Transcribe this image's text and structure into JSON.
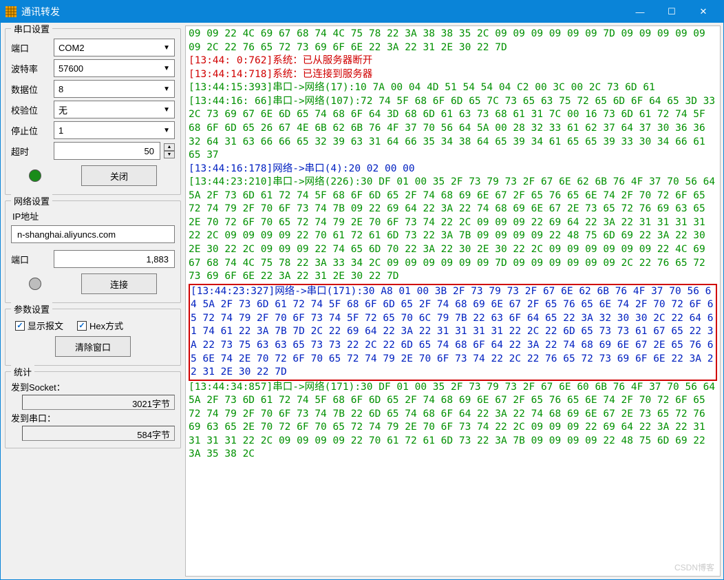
{
  "window": {
    "title": "通讯转发"
  },
  "titlebar": {
    "min": "—",
    "max": "☐",
    "close": "✕"
  },
  "serial": {
    "legend": "串口设置",
    "port_label": "端口",
    "port_value": "COM2",
    "baud_label": "波特率",
    "baud_value": "57600",
    "databits_label": "数据位",
    "databits_value": "8",
    "parity_label": "校验位",
    "parity_value": "无",
    "stopbits_label": "停止位",
    "stopbits_value": "1",
    "timeout_label": "超时",
    "timeout_value": "50",
    "close_btn": "关闭"
  },
  "net": {
    "legend": "网络设置",
    "ip_label": "IP地址",
    "ip_value": "n-shanghai.aliyuncs.com",
    "port_label": "端口",
    "port_value": "1,883",
    "connect_btn": "连接"
  },
  "params": {
    "legend": "参数设置",
    "show_packet": "显示报文",
    "hex_mode": "Hex方式",
    "clear_btn": "清除窗口"
  },
  "stats": {
    "legend": "统计",
    "to_socket_label": "发到Socket：",
    "to_socket_value": "3021字节",
    "to_serial_label": "发到串口：",
    "to_serial_value": "584字节"
  },
  "log": [
    {
      "c": "g",
      "t": "09 09 22 4C 69 67 68 74 4C 75 78 22 3A 38 38 35 2C 09 09 09 09 09 09 7D 09 09 09 09 09 09 2C 22 76 65 72 73 69 6F 6E 22 3A 22 31 2E 30 22 7D"
    },
    {
      "c": "r",
      "t": "[13:44: 0:762]系统：已从服务器断开"
    },
    {
      "c": "r",
      "t": "[13:44:14:718]系统：已连接到服务器"
    },
    {
      "c": "g",
      "t": "[13:44:15:393]串口->网络(17):10 7A 00 04 4D 51 54 54 04 C2 00 3C 00 2C 73 6D 61"
    },
    {
      "c": "g",
      "t": "[13:44:16: 66]串口->网络(107):72 74 5F 68 6F 6D 65 7C 73 65 63 75 72 65 6D 6F 64 65 3D 33 2C 73 69 67 6E 6D 65 74 68 6F 64 3D 68 6D 61 63 73 68 61 31 7C 00 16 73 6D 61 72 74 5F 68 6F 6D 65 26 67 4E 6B 62 6B 76 4F 37 70 56 64 5A 00 28 32 33 61 62 37 64 37 30 36 36 32 64 31 63 66 66 65 32 39 63 31 64 66 35 34 38 64 65 39 34 61 65 65 39 33 30 34 66 61 65 37"
    },
    {
      "c": "b",
      "t": "[13:44:16:178]网络->串口(4):20 02 00 00"
    },
    {
      "c": "g",
      "t": "[13:44:23:210]串口->网络(226):30 DF 01 00 35 2F 73 79 73 2F 67 6E 62 6B 76 4F 37 70 56 64 5A 2F 73 6D 61 72 74 5F 68 6F 6D 65 2F 74 68 69 6E 67 2F 65 76 65 6E 74 2F 70 72 6F 65 72 74 79 2F 70 6F 73 74 7B 09 22 69 64 22 3A 22 74 68 69 6E 67 2E 73 65 72 76 69 63 65 2E 70 72 6F 70 65 72 74 79 2E 70 6F 73 74 22 2C 09 09 09 22 69 64 22 3A 22 31 31 31 31 22 2C 09 09 09 09 22 70 61 72 61 6D 73 22 3A 7B 09 09 09 09 22 48 75 6D 69 22 3A 22 30 2E 30 22 2C 09 09 09 22 74 65 6D 70 22 3A 22 30 2E 30 22 2C 09 09 09 09 09 09 22 4C 69 67 68 74 4C 75 78 22 3A 33 34 2C 09 09 09 09 09 09 7D 09 09 09 09 09 09 2C 22 76 65 72 73 69 6F 6E 22 3A 22 31 2E 30 22 7D"
    },
    {
      "c": "b",
      "box": true,
      "t": "[13:44:23:327]网络->串口(171):30 A8 01 00 3B 2F 73 79 73 2F 67 6E 62 6B 76 4F 37 70 56 64 5A 2F 73 6D 61 72 74 5F 68 6F 6D 65 2F 74 68 69 6E 67 2F 65 76 65 6E 74 2F 70 72 6F 65 72 74 79 2F 70 6F 73 74 5F 72 65 70 6C 79 7B 22 63 6F 64 65 22 3A 32 30 30 2C 22 64 61 74 61 22 3A 7B 7D 2C 22 69 64 22 3A 22 31 31 31 31 22 2C 22 6D 65 73 73 61 67 65 22 3A 22 73 75 63 63 65 73 73 22 2C 22 6D 65 74 68 6F 64 22 3A 22 74 68 69 6E 67 2E 65 76 65 6E 74 2E 70 72 6F 70 65 72 74 79 2E 70 6F 73 74 22 2C 22 76 65 72 73 69 6F 6E 22 3A 22 31 2E 30 22 7D"
    },
    {
      "c": "g",
      "t": "[13:44:34:857]串口->网络(171):30 DF 01 00 35 2F 73 79 73 2F 67 6E 60 6B 76 4F 37 70 56 64 5A 2F 73 6D 61 72 74 5F 68 6F 6D 65 2F 74 68 69 6E 67 2F 65 76 65 6E 74 2F 70 72 6F 65 72 74 79 2F 70 6F 73 74 7B 22 6D 65 74 68 6F 64 22 3A 22 74 68 69 6E 67 2E 73 65 72 76 69 63 65 2E 70 72 6F 70 65 72 74 79 2E 70 6F 73 74 22 2C 09 09 09 22 69 64 22 3A 22 31 31 31 31 22 2C 09 09 09 09 22 70 61 72 61 6D 73 22 3A 7B 09 09 09 09 22 48 75 6D 69 22 3A 35 38 2C"
    }
  ],
  "watermark": "CSDN博客"
}
